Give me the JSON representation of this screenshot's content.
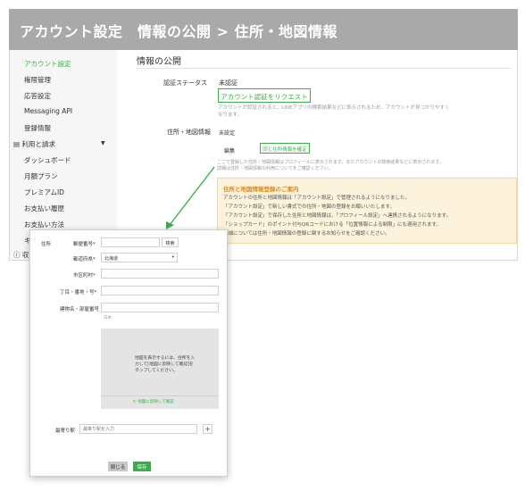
{
  "header": {
    "title": "アカウント設定　情報の公開 > 住所・地図情報"
  },
  "sidebar": {
    "items": [
      {
        "label": "アカウント設定"
      },
      {
        "label": "権限管理"
      },
      {
        "label": "応答設定"
      },
      {
        "label": "Messaging API"
      },
      {
        "label": "登録情報"
      }
    ],
    "group": {
      "label": "利用と請求",
      "items": [
        {
          "label": "ダッシュボード"
        },
        {
          "label": "月額プラン"
        },
        {
          "label": "プレミアムID"
        },
        {
          "label": "お支払い履歴"
        },
        {
          "label": "お支払い方法"
        },
        {
          "label": "キ"
        }
      ]
    },
    "trailing": "収"
  },
  "main": {
    "section_title": "情報の公開",
    "auth_label": "認証ステータス",
    "auth_value": "未認証",
    "auth_button": "アカウント認証をリクエスト",
    "auth_note": "アカウントが認証されると、LINEアプリの検索結果などに表示されるため、アカウントが見つかりやすく\nなります。",
    "address_label": "住所・地図情報",
    "address_value": "未設定",
    "edit_label": "編集",
    "confirm_button": "同じ住所情報を確定",
    "address_note": "ここで登録した住所・地図情報はプロフィールに表示されます。またアカウントの検索結果などに表示されます。\n詳細は住所・地図情報の利用についてをご確認ください。"
  },
  "notice": {
    "title": "住所と地図情報登録のご案内",
    "lines": [
      "アカウントの住所と地図情報は「アカウント設定」で管理されるようになりました。",
      "「アカウント設定」で新しい書式での住所・地図の登録をお願いいたします。",
      "「アカウント設定」で保存した住所と地図情報は、「プロフィール設定」へ連携されるようになります。",
      "「ショップカード」のポイント付与QRコードにおける「位置情報による制限」にも適用されます。",
      "詳細については住所・地図情報の登録に関するお知らせをご確認ください。"
    ]
  },
  "modal": {
    "address_label": "住所",
    "postal_label": "郵便番号*",
    "postal_value": "",
    "search_button": "検索",
    "prefecture_label": "都道府県*",
    "prefecture_value": "北海道",
    "city_label": "市区町村*",
    "city_value": "",
    "street_label": "丁目・番地・号*",
    "street_value": "",
    "building_label": "建物名・部屋番号",
    "building_value": "",
    "country_note": "日本",
    "map_instruction": "地図を表示するには、住所を入力して[地図に反映して確認]をタップしてください。",
    "map_link": "地図に反映して確認",
    "station_label": "最寄り駅",
    "station_placeholder": "最寄り駅を入力",
    "plus_symbol": "+",
    "close_button": "閉じる",
    "save_button": "保存"
  },
  "colors": {
    "accent": "#3aae49",
    "header_bg": "#a9a9a9",
    "notice_bg": "#fdf2dc",
    "notice_title": "#e08a17"
  }
}
